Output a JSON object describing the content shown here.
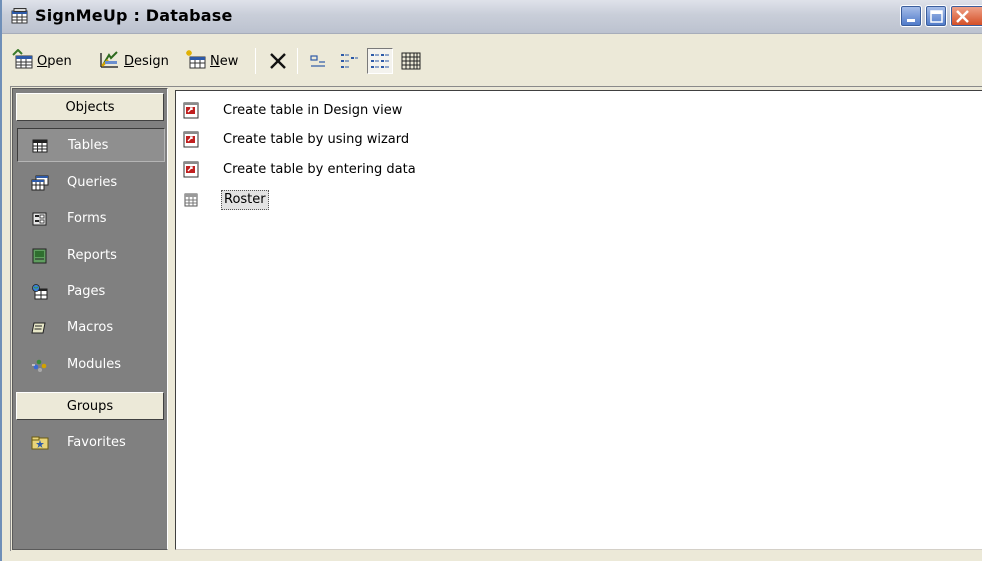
{
  "window": {
    "title": "SignMeUp : Database",
    "accent": "#0a246a"
  },
  "titlebar_buttons": [
    {
      "name": "minimize-button",
      "icon": "minimize-icon"
    },
    {
      "name": "maximize-button",
      "icon": "maximize-icon"
    },
    {
      "name": "close-button",
      "icon": "close-icon"
    }
  ],
  "toolbar": {
    "open_label_underlined": "O",
    "open_label_rest": "pen",
    "design_label_underlined": "D",
    "design_label_rest": "esign",
    "new_label_underlined": "N",
    "new_label_rest": "ew",
    "delete_icon": "delete-x-icon",
    "views": [
      {
        "name": "large-icons-view",
        "icon": "large-icons-icon"
      },
      {
        "name": "small-icons-view",
        "icon": "small-icons-icon"
      },
      {
        "name": "list-view",
        "icon": "list-icon",
        "active": true
      },
      {
        "name": "details-view",
        "icon": "details-icon"
      }
    ]
  },
  "objects_bar": {
    "header": "Objects",
    "items": [
      {
        "label": "Tables",
        "icon": "table-icon",
        "selected": true
      },
      {
        "label": "Queries",
        "icon": "query-icon"
      },
      {
        "label": "Forms",
        "icon": "form-icon"
      },
      {
        "label": "Reports",
        "icon": "report-icon"
      },
      {
        "label": "Pages",
        "icon": "page-icon"
      },
      {
        "label": "Macros",
        "icon": "macro-icon"
      },
      {
        "label": "Modules",
        "icon": "module-icon"
      }
    ],
    "groups_header": "Groups",
    "group_items": [
      {
        "label": "Favorites",
        "icon": "favorites-folder-icon"
      }
    ]
  },
  "list": {
    "items": [
      {
        "label": "Create table in Design view",
        "icon": "shortcut-icon"
      },
      {
        "label": "Create table by using wizard",
        "icon": "shortcut-icon"
      },
      {
        "label": "Create table by entering data",
        "icon": "shortcut-icon"
      },
      {
        "label": "Roster",
        "icon": "table-icon",
        "selected": true
      }
    ]
  }
}
